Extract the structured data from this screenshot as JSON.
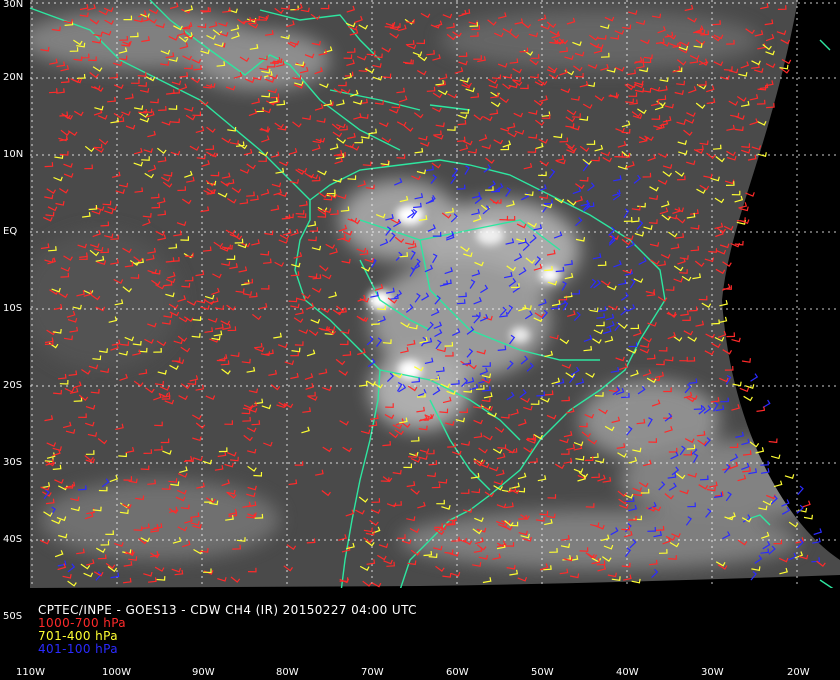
{
  "title": "CPTEC/INPE - GOES13 - CDW CH4 (IR) 20150227 04:00 UTC",
  "legend": [
    {
      "label": "1000-700 hPa",
      "color": "#ff2a2a"
    },
    {
      "label": "701-400 hPa",
      "color": "#ffff33"
    },
    {
      "label": "401-100 hPa",
      "color": "#2b2bff"
    }
  ],
  "latitude_labels": [
    "30N",
    "20N",
    "10N",
    "EQ",
    "10S",
    "20S",
    "30S",
    "40S",
    "50S"
  ],
  "longitude_labels": [
    "110W",
    "100W",
    "90W",
    "80W",
    "70W",
    "60W",
    "50W",
    "40W",
    "30W",
    "20W"
  ],
  "colors": {
    "coastline": "#2ee6a0",
    "grid": "#ffffff",
    "background": "#000000"
  }
}
